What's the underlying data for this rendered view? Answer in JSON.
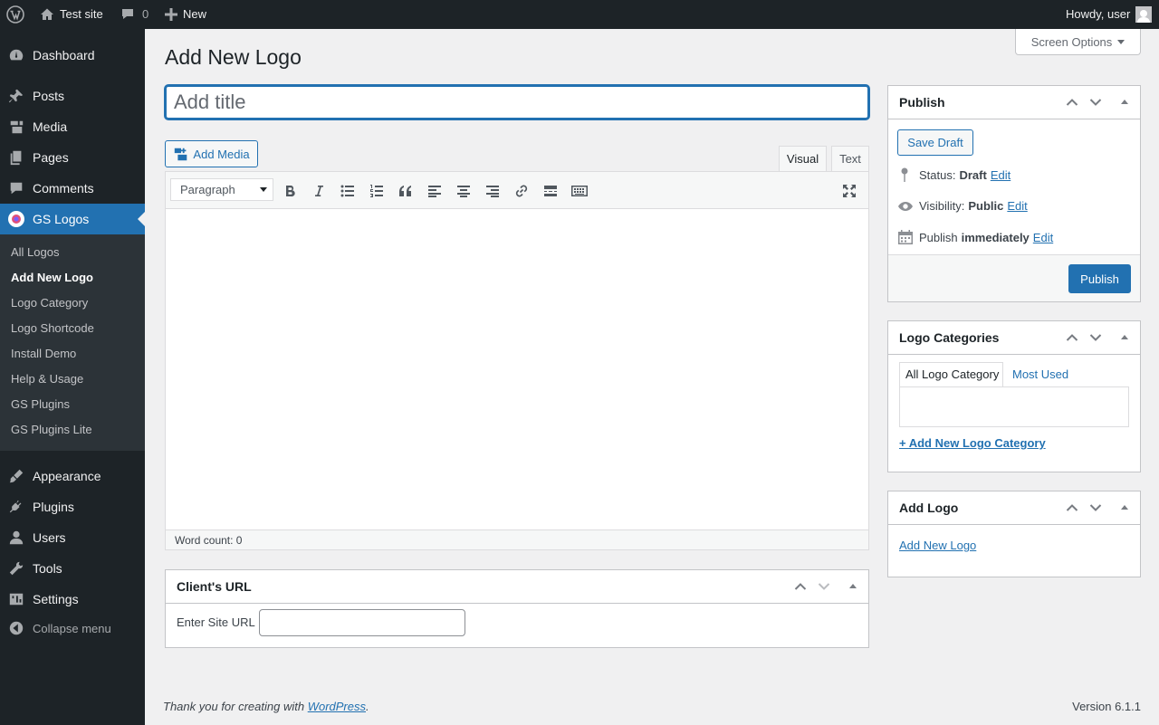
{
  "admin_bar": {
    "site_name": "Test site",
    "comments_count": "0",
    "new_label": "New",
    "howdy": "Howdy, user"
  },
  "sidebar": {
    "items": [
      {
        "label": "Dashboard",
        "icon": "dashboard-icon"
      },
      {
        "label": "Posts",
        "icon": "pin-icon"
      },
      {
        "label": "Media",
        "icon": "media-icon"
      },
      {
        "label": "Pages",
        "icon": "pages-icon"
      },
      {
        "label": "Comments",
        "icon": "comments-icon"
      },
      {
        "label": "GS Logos",
        "icon": "gs-logos-icon"
      },
      {
        "label": "Appearance",
        "icon": "appearance-icon"
      },
      {
        "label": "Plugins",
        "icon": "plugins-icon"
      },
      {
        "label": "Users",
        "icon": "users-icon"
      },
      {
        "label": "Tools",
        "icon": "tools-icon"
      },
      {
        "label": "Settings",
        "icon": "settings-icon"
      },
      {
        "label": "Collapse menu",
        "icon": "collapse-icon"
      }
    ],
    "submenu": [
      "All Logos",
      "Add New Logo",
      "Logo Category",
      "Logo Shortcode",
      "Install Demo",
      "Help & Usage",
      "GS Plugins",
      "GS Plugins Lite"
    ]
  },
  "page": {
    "title": "Add New Logo",
    "screen_options": "Screen Options",
    "title_placeholder": "Add title"
  },
  "editor": {
    "add_media": "Add Media",
    "tab_visual": "Visual",
    "tab_text": "Text",
    "format": "Paragraph",
    "word_count": "Word count: 0"
  },
  "client_url": {
    "title": "Client's URL",
    "label": "Enter Site URL",
    "value": ""
  },
  "publish": {
    "title": "Publish",
    "save_draft": "Save Draft",
    "status_label": "Status:",
    "status_value": "Draft",
    "visibility_label": "Visibility:",
    "visibility_value": "Public",
    "publish_label": "Publish",
    "publish_value": "immediately",
    "edit": "Edit",
    "publish_button": "Publish"
  },
  "categories": {
    "title": "Logo Categories",
    "tab_all": "All Logo Category",
    "tab_most": "Most Used",
    "add_new": "+ Add New Logo Category"
  },
  "add_logo": {
    "title": "Add Logo",
    "link": "Add New Logo"
  },
  "footer": {
    "thanks_prefix": "Thank you for creating with",
    "wordpress": "WordPress",
    "thanks_suffix": ".",
    "version": "Version 6.1.1"
  },
  "colors": {
    "admin_bg": "#1d2327",
    "accent": "#2271b1",
    "page_bg": "#f0f0f1"
  }
}
